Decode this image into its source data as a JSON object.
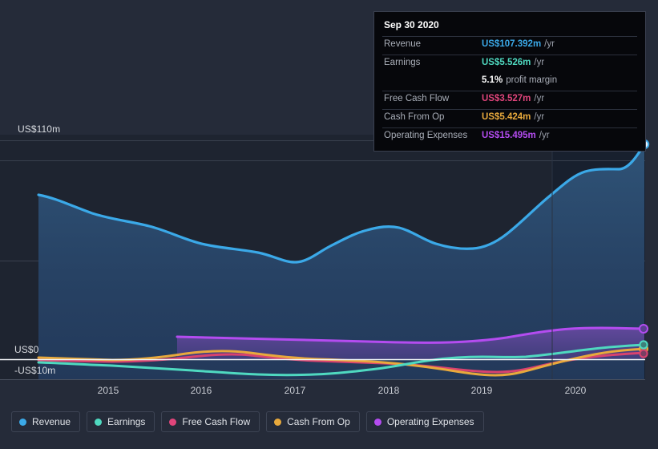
{
  "tooltip": {
    "title": "Sep 30 2020",
    "rows": [
      {
        "key": "Revenue",
        "value": "US$107.392m",
        "unit": "/yr",
        "color": "#3ba9e8"
      },
      {
        "key": "Earnings",
        "value": "US$5.526m",
        "unit": "/yr",
        "color": "#4fd9c0"
      },
      {
        "key": "Free Cash Flow",
        "value": "US$3.527m",
        "unit": "/yr",
        "color": "#e0457b"
      },
      {
        "key": "Cash From Op",
        "value": "US$5.424m",
        "unit": "/yr",
        "color": "#e8a93c"
      },
      {
        "key": "Operating Expenses",
        "value": "US$15.495m",
        "unit": "/yr",
        "color": "#b44cf0"
      }
    ],
    "profit_margin_value": "5.1%",
    "profit_margin_label": "profit margin"
  },
  "axis": {
    "y_labels": [
      "US$110m",
      "US$0",
      "-US$10m"
    ],
    "x_labels": [
      "2015",
      "2016",
      "2017",
      "2018",
      "2019",
      "2020"
    ]
  },
  "legend": [
    {
      "label": "Revenue",
      "color": "#3ba9e8"
    },
    {
      "label": "Earnings",
      "color": "#4fd9c0"
    },
    {
      "label": "Free Cash Flow",
      "color": "#e0457b"
    },
    {
      "label": "Cash From Op",
      "color": "#e8a93c"
    },
    {
      "label": "Operating Expenses",
      "color": "#b44cf0"
    }
  ],
  "chart_data": {
    "type": "area",
    "title": "",
    "xlabel": "",
    "ylabel": "US$",
    "ylim": [
      -10,
      110
    ],
    "y_ticks": [
      110,
      0,
      -10
    ],
    "x_ticks": [
      "2015",
      "2016",
      "2017",
      "2018",
      "2019",
      "2020"
    ],
    "grid": true,
    "legend_position": "bottom",
    "units": "US$ millions per year",
    "currency": "USD",
    "highlight_date": "Sep 30 2020",
    "forecast_divider_x": "mid-2020",
    "x": [
      "2014.55",
      "2014.8",
      "2015.05",
      "2015.3",
      "2015.55",
      "2015.8",
      "2016.05",
      "2016.3",
      "2016.55",
      "2016.8",
      "2017.05",
      "2017.3",
      "2017.55",
      "2017.8",
      "2018.05",
      "2018.3",
      "2018.55",
      "2018.8",
      "2019.05",
      "2019.3",
      "2019.55",
      "2019.8",
      "2020.05",
      "2020.3",
      "2020.75"
    ],
    "series": [
      {
        "name": "Revenue",
        "color": "#3ba9e8",
        "filled": true,
        "values": [
          82.6,
          78.0,
          74.0,
          71.5,
          70.0,
          67.0,
          64.5,
          63.0,
          61.5,
          60.5,
          58.5,
          55.5,
          52.5,
          54.0,
          57.5,
          61.0,
          62.0,
          60.0,
          58.5,
          58.0,
          58.5,
          62.0,
          72.0,
          88.0,
          107.392
        ],
        "last_value": 107.392
      },
      {
        "name": "Earnings",
        "color": "#4fd9c0",
        "filled": false,
        "values": [
          -1.4,
          -1.6,
          -1.8,
          -2.0,
          -2.2,
          -2.4,
          -2.6,
          -3.0,
          -3.4,
          -3.8,
          -4.0,
          -4.0,
          -3.8,
          -3.2,
          -2.6,
          -2.2,
          -2.0,
          -2.2,
          -2.6,
          -3.0,
          -2.8,
          -1.8,
          -0.4,
          2.0,
          5.526
        ],
        "last_value": 5.526
      },
      {
        "name": "Free Cash Flow",
        "color": "#e0457b",
        "filled": false,
        "values": [
          -0.2,
          -0.3,
          -0.4,
          -0.5,
          -0.6,
          -0.6,
          -0.5,
          -0.2,
          0.4,
          0.8,
          0.6,
          0.2,
          -0.2,
          -0.4,
          -0.5,
          -0.6,
          -0.8,
          -1.2,
          -2.2,
          -3.6,
          -3.0,
          -1.8,
          -0.6,
          1.2,
          3.527
        ],
        "last_value": 3.527
      },
      {
        "name": "Cash From Op",
        "color": "#e8a93c",
        "filled": false,
        "values": [
          0.6,
          0.4,
          0.2,
          0.0,
          -0.2,
          -0.2,
          0.0,
          0.4,
          1.0,
          1.4,
          1.0,
          0.6,
          0.2,
          0.0,
          -0.2,
          -0.4,
          -0.6,
          -1.0,
          -2.0,
          -3.4,
          -2.8,
          -1.6,
          -0.4,
          1.6,
          5.424
        ],
        "last_value": 5.424
      },
      {
        "name": "Operating Expenses",
        "color": "#b44cf0",
        "filled": true,
        "start_x": "2015.75",
        "values": [
          null,
          null,
          null,
          null,
          null,
          11.6,
          11.5,
          11.3,
          11.2,
          11.0,
          10.9,
          10.8,
          10.6,
          10.5,
          10.4,
          10.2,
          10.0,
          9.9,
          10.0,
          10.4,
          11.2,
          12.4,
          13.6,
          14.6,
          15.495
        ],
        "last_value": 15.495
      }
    ]
  }
}
